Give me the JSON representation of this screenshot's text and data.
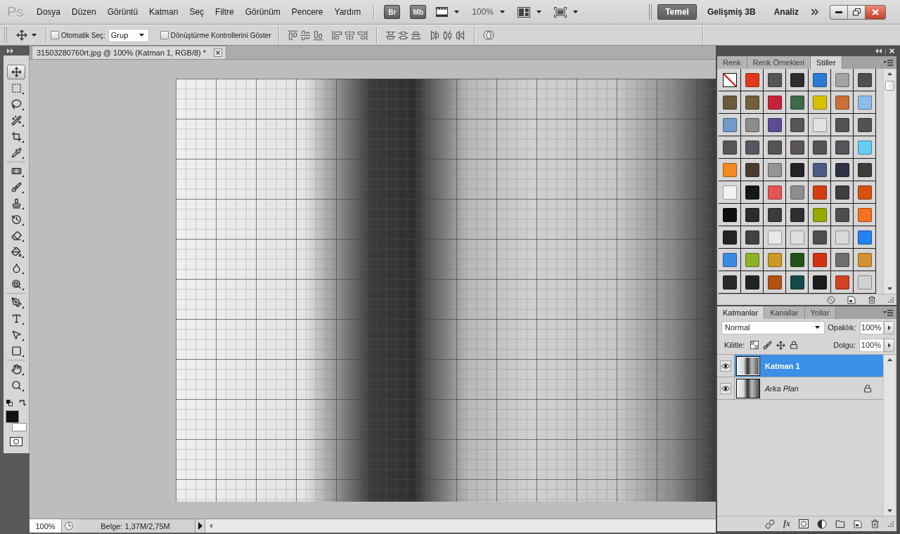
{
  "app_bar": {
    "logo": "Ps",
    "menu": [
      "Dosya",
      "Düzen",
      "Görüntü",
      "Katman",
      "Seç",
      "Filtre",
      "Görünüm",
      "Pencere",
      "Yardım"
    ],
    "launchers": [
      "Br",
      "Mb"
    ],
    "zoom": "100%",
    "workspaces": [
      {
        "label": "Temel",
        "selected": true
      },
      {
        "label": "Gelişmiş 3B",
        "selected": false
      },
      {
        "label": "Analiz",
        "selected": false
      }
    ]
  },
  "options_bar": {
    "auto_select": {
      "label": "Otomatik Seç:",
      "checked": false,
      "target": "Grup"
    },
    "transform_controls": {
      "label": "Dönüştürme Kontrollerini Göster",
      "checked": false
    }
  },
  "tool_groups": [
    {
      "tools": [
        {
          "kind": "move",
          "selected": true
        },
        {
          "kind": "marquee",
          "selected": false
        },
        {
          "kind": "lasso",
          "selected": false
        },
        {
          "kind": "quick_selection",
          "selected": false
        },
        {
          "kind": "crop",
          "selected": false
        },
        {
          "kind": "eyedropper",
          "selected": false
        }
      ]
    },
    {
      "tools": [
        {
          "kind": "healing",
          "selected": false
        },
        {
          "kind": "brush",
          "selected": false
        },
        {
          "kind": "clone_stamp",
          "selected": false
        },
        {
          "kind": "history_brush",
          "selected": false
        },
        {
          "kind": "eraser",
          "selected": false
        },
        {
          "kind": "paint_bucket",
          "selected": false
        },
        {
          "kind": "blur",
          "selected": false
        },
        {
          "kind": "dodge",
          "selected": false
        }
      ]
    },
    {
      "tools": [
        {
          "kind": "pen",
          "selected": false
        },
        {
          "kind": "type",
          "selected": false
        },
        {
          "kind": "path_selection",
          "selected": false
        },
        {
          "kind": "shape",
          "selected": false
        }
      ]
    },
    {
      "tools": [
        {
          "kind": "hand",
          "selected": false
        },
        {
          "kind": "zoom",
          "selected": false
        }
      ]
    }
  ],
  "color_swatches": [
    {
      "kind": "foreground",
      "color": "#0e1311"
    },
    {
      "kind": "background",
      "color": "#ffffff"
    }
  ],
  "document": {
    "tab_title": "31503280760rt.jpg @ 100% (Katman 1, RGB/8) *",
    "zoom": "100%",
    "info": "Belge: 1,37M/2,75M"
  },
  "styles_panel": {
    "tabs": [
      {
        "label": "Renk",
        "selected": false
      },
      {
        "label": "Renk Örnekleri",
        "selected": false
      },
      {
        "label": "Stiller",
        "selected": true
      }
    ],
    "styles": [
      {
        "kind": "none"
      },
      {
        "kind": "swatch",
        "color": "#e2381a"
      },
      {
        "kind": "swatch",
        "color": "#555555"
      },
      {
        "kind": "swatch",
        "color": "#2e2e2e"
      },
      {
        "kind": "swatch",
        "color": "#2d7bd0"
      },
      {
        "kind": "swatch",
        "color": "#a3a3a3"
      },
      {
        "kind": "swatch",
        "color": "#4f4f4f"
      },
      {
        "kind": "swatch",
        "color": "#6b5a3c"
      },
      {
        "kind": "swatch",
        "color": "#71603a"
      },
      {
        "kind": "swatch",
        "color": "#c3243a"
      },
      {
        "kind": "swatch",
        "color": "#3e6a4a"
      },
      {
        "kind": "swatch",
        "color": "#d6c200"
      },
      {
        "kind": "swatch",
        "color": "#c87036"
      },
      {
        "kind": "swatch",
        "color": "#8cbcec"
      },
      {
        "kind": "swatch",
        "color": "#6f9cc8"
      },
      {
        "kind": "swatch",
        "color": "#8c8c8c"
      },
      {
        "kind": "swatch",
        "color": "#5c4c94"
      },
      {
        "kind": "swatch",
        "color": "#565656"
      },
      {
        "kind": "swatch",
        "color": "#e2e2e2"
      },
      {
        "kind": "swatch",
        "color": "#535353"
      },
      {
        "kind": "swatch",
        "color": "#4f5353"
      },
      {
        "kind": "swatch",
        "color": "#565656"
      },
      {
        "kind": "swatch",
        "color": "#5a5660"
      },
      {
        "kind": "swatch",
        "color": "#555653"
      },
      {
        "kind": "swatch",
        "color": "#5a5458"
      },
      {
        "kind": "swatch",
        "color": "#525652"
      },
      {
        "kind": "swatch",
        "color": "#545459"
      },
      {
        "kind": "swatch",
        "color": "#66ccf2"
      },
      {
        "kind": "swatch",
        "color": "#f28a22"
      },
      {
        "kind": "swatch",
        "color": "#4b3b2f"
      },
      {
        "kind": "swatch",
        "color": "#949494"
      },
      {
        "kind": "swatch",
        "color": "#242424"
      },
      {
        "kind": "swatch",
        "color": "#4b5b82"
      },
      {
        "kind": "swatch",
        "color": "#2f3142"
      },
      {
        "kind": "swatch",
        "color": "#3c3c3c"
      },
      {
        "kind": "swatch",
        "color": "#f2f2f2"
      },
      {
        "kind": "swatch",
        "color": "#161616"
      },
      {
        "kind": "swatch",
        "color": "#e45252"
      },
      {
        "kind": "swatch",
        "color": "#8e8e8e"
      },
      {
        "kind": "swatch",
        "color": "#d43c12"
      },
      {
        "kind": "swatch",
        "color": "#3e3e3e"
      },
      {
        "kind": "swatch",
        "color": "#d45212"
      },
      {
        "kind": "swatch",
        "color": "#0e0e0e"
      },
      {
        "kind": "swatch",
        "color": "#2b2b2b"
      },
      {
        "kind": "swatch",
        "color": "#3b3b3b"
      },
      {
        "kind": "swatch",
        "color": "#2f2f2f"
      },
      {
        "kind": "swatch",
        "color": "#98aa02"
      },
      {
        "kind": "swatch",
        "color": "#4e4e4e"
      },
      {
        "kind": "swatch",
        "color": "#f27222"
      },
      {
        "kind": "swatch",
        "color": "#232323"
      },
      {
        "kind": "swatch",
        "color": "#414141"
      },
      {
        "kind": "swatch",
        "color": "#e9e9e9"
      },
      {
        "kind": "swatch",
        "color": "#dfdfdf"
      },
      {
        "kind": "swatch",
        "color": "#4f4f4f"
      },
      {
        "kind": "swatch",
        "color": "#d9d9d9"
      },
      {
        "kind": "swatch",
        "color": "#2282f2"
      },
      {
        "kind": "swatch",
        "color": "#3a8ae2"
      },
      {
        "kind": "swatch",
        "color": "#8ab222"
      },
      {
        "kind": "swatch",
        "color": "#ca9a22"
      },
      {
        "kind": "swatch",
        "color": "#22521a"
      },
      {
        "kind": "swatch",
        "color": "#d23212"
      },
      {
        "kind": "swatch",
        "color": "#6e6e6e"
      },
      {
        "kind": "swatch",
        "color": "#d29232"
      },
      {
        "kind": "swatch",
        "color": "#292929"
      },
      {
        "kind": "swatch",
        "color": "#232323"
      },
      {
        "kind": "swatch",
        "color": "#b25212"
      },
      {
        "kind": "swatch",
        "color": "#124a4a"
      },
      {
        "kind": "swatch",
        "color": "#1b1b1b"
      },
      {
        "kind": "swatch",
        "color": "#d24222"
      },
      {
        "kind": "swatch",
        "color": "#d2d2d2"
      }
    ]
  },
  "layers_panel": {
    "tabs": [
      {
        "label": "Katmanlar",
        "selected": true
      },
      {
        "label": "Kanallar",
        "selected": false
      },
      {
        "label": "Yollar",
        "selected": false
      }
    ],
    "blend_mode": "Normal",
    "opacity_label": "Opaklık:",
    "opacity": "100%",
    "lock_label": "Kilitle:",
    "fill_label": "Dolgu:",
    "fill": "100%",
    "layers": [
      {
        "name": "Katman 1",
        "kind": "layer",
        "selected": true,
        "visible": true,
        "locked": false
      },
      {
        "name": "Arka Plan",
        "kind": "background",
        "selected": false,
        "visible": true,
        "locked": true
      }
    ],
    "style_button": "fx"
  }
}
